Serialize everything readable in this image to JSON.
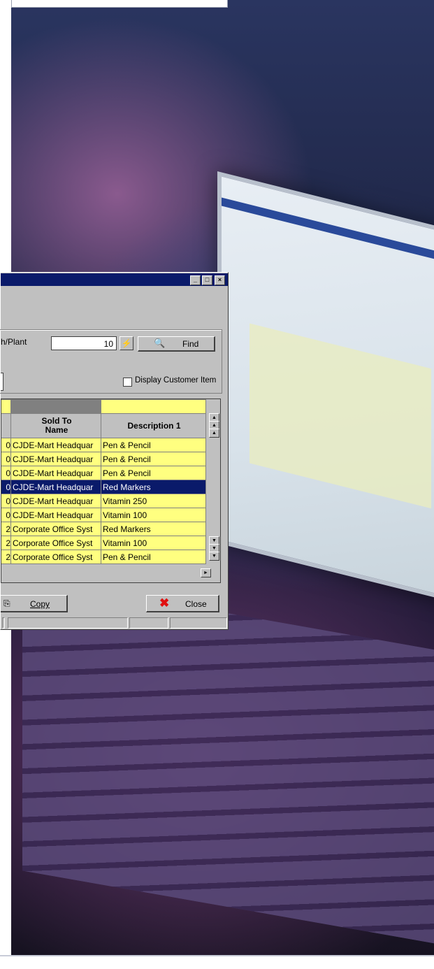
{
  "dialog": {
    "title_buttons": {
      "minimize": "_",
      "maximize": "□",
      "close": "×"
    },
    "branch_plant_label": "h/Plant",
    "branch_plant_value": "10",
    "find_label": "Find",
    "display_customer_item_label": "Display Customer Item",
    "columns": {
      "col_sold_to_name": "Sold To\nName",
      "col_description": "Description 1"
    },
    "rows": [
      {
        "num": "0",
        "sold_to": "CJDE-Mart Headquar",
        "desc": "Pen & Pencil"
      },
      {
        "num": "0",
        "sold_to": "CJDE-Mart Headquar",
        "desc": "Pen & Pencil"
      },
      {
        "num": "0",
        "sold_to": "CJDE-Mart Headquar",
        "desc": "Pen & Pencil"
      },
      {
        "num": "0",
        "sold_to": "CJDE-Mart Headquar",
        "desc": "Red Markers"
      },
      {
        "num": "0",
        "sold_to": "CJDE-Mart Headquar",
        "desc": "Vitamin 250"
      },
      {
        "num": "0",
        "sold_to": "CJDE-Mart Headquar",
        "desc": "Vitamin 100"
      },
      {
        "num": "2",
        "sold_to": "Corporate Office Syst",
        "desc": "Red Markers"
      },
      {
        "num": "2",
        "sold_to": "Corporate Office Syst",
        "desc": "Vitamin 100"
      },
      {
        "num": "2",
        "sold_to": "Corporate Office Syst",
        "desc": "Pen & Pencil"
      }
    ],
    "selected_row": 3,
    "copy_label": "Copy",
    "close_label": "Close"
  }
}
